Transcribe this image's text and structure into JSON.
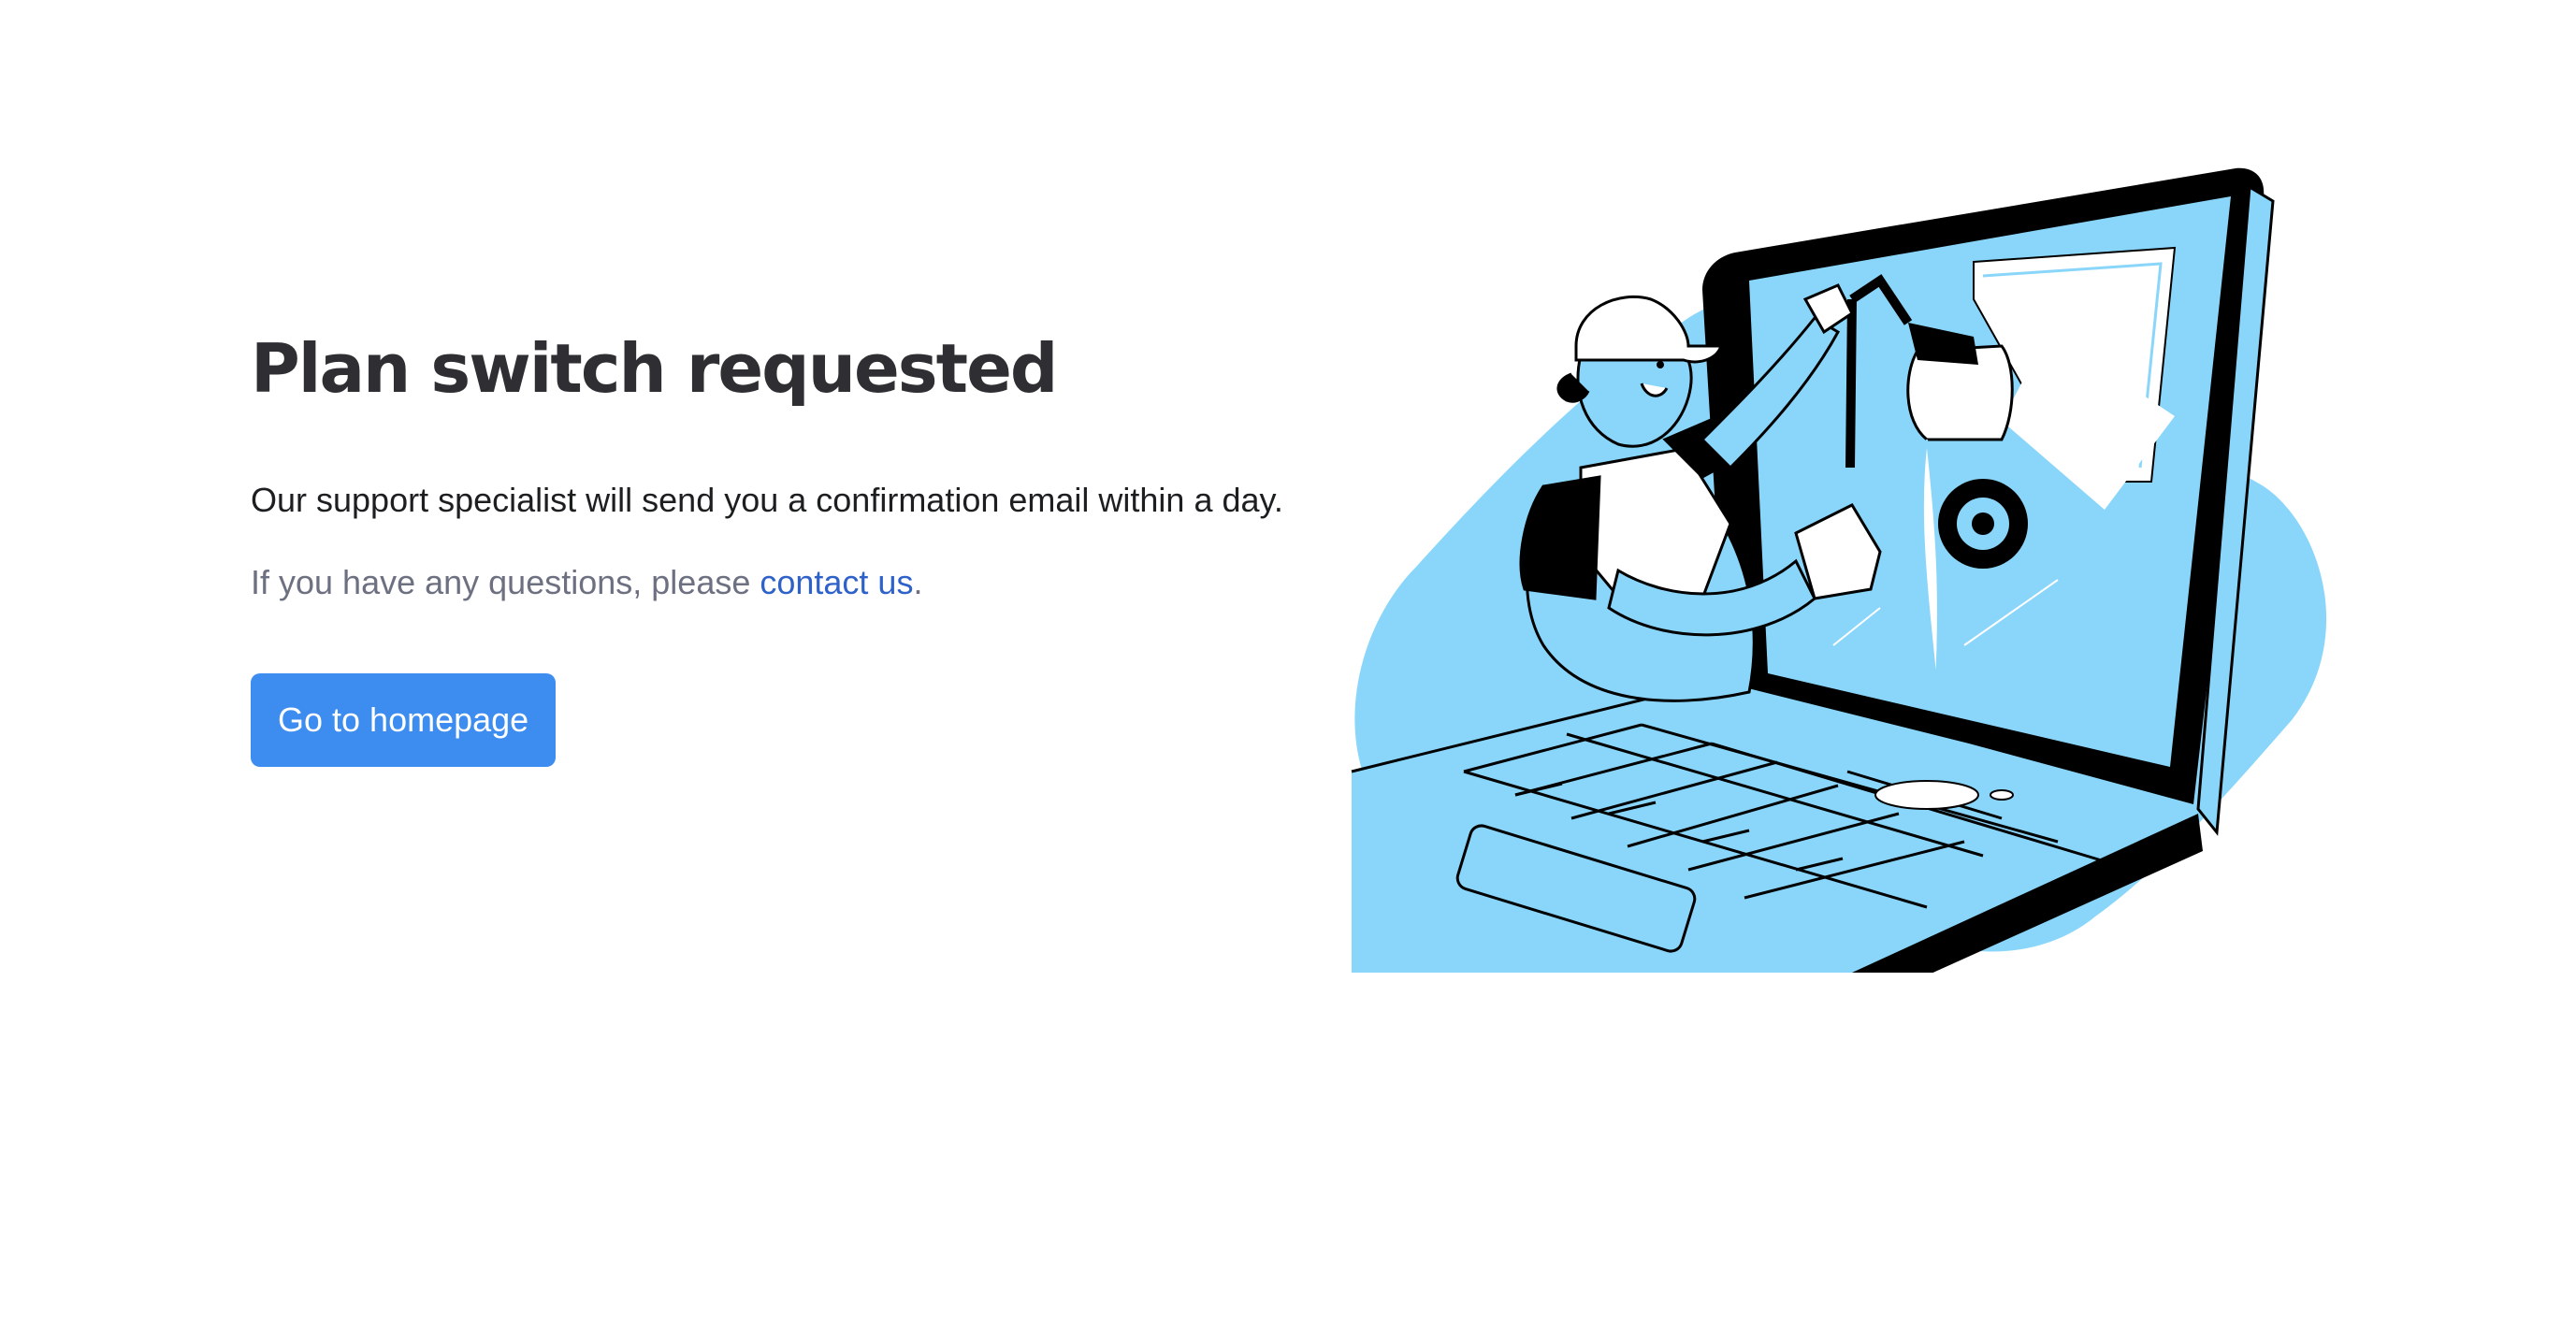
{
  "page": {
    "title": "Plan switch requested",
    "message": "Our support specialist will send you a confirmation email within a day.",
    "questions_prefix": "If you have any questions, please ",
    "contact_link": "contact us",
    "questions_suffix": ".",
    "button_label": "Go to homepage"
  },
  "colors": {
    "primary": "#3d8cf0",
    "link": "#2f62c9",
    "illustration_blue": "#8ad6fa"
  }
}
